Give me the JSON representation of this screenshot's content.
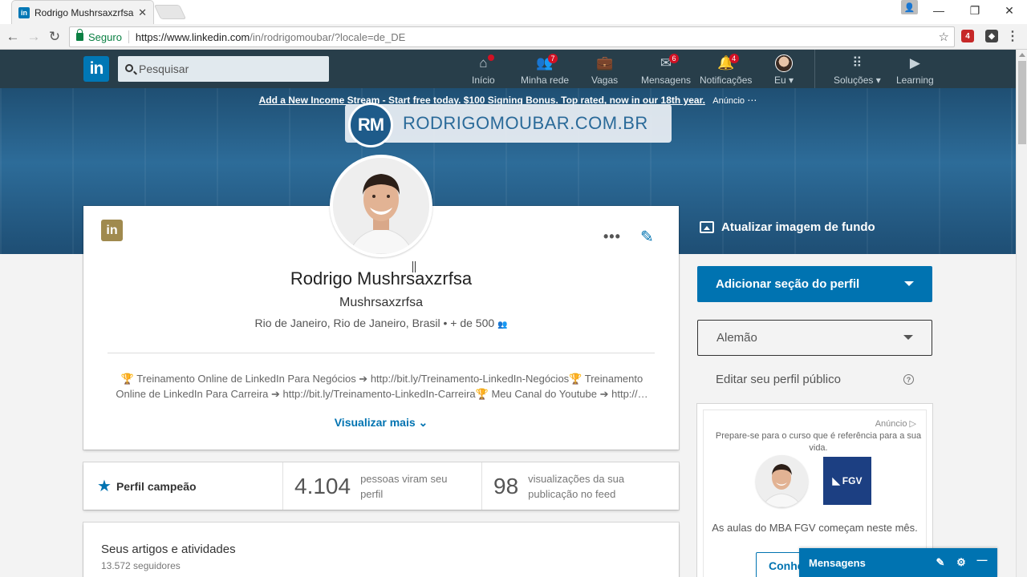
{
  "browser": {
    "tab_title": "Rodrigo Mushrsaxzrfsa | L",
    "tab_favicon": "in",
    "secure_label": "Seguro",
    "url_host": "https://www.linkedin.com",
    "url_path": "/in/rodrigomoubar/?locale=de_DE",
    "ext_badge": "4"
  },
  "nav": {
    "logo": "in",
    "search_placeholder": "Pesquisar",
    "items": [
      {
        "label": "Início",
        "icon": "home-icon",
        "badge": ""
      },
      {
        "label": "Minha rede",
        "icon": "network-icon",
        "badge": "7"
      },
      {
        "label": "Vagas",
        "icon": "briefcase-icon",
        "badge": ""
      },
      {
        "label": "Mensagens",
        "icon": "messages-icon",
        "badge": "6"
      },
      {
        "label": "Notificações",
        "icon": "bell-icon",
        "badge": "4"
      },
      {
        "label": "Eu",
        "icon": "avatar",
        "badge": ""
      },
      {
        "label": "Soluções",
        "icon": "grid-icon",
        "badge": ""
      },
      {
        "label": "Learning",
        "icon": "learning-icon",
        "badge": ""
      }
    ]
  },
  "banner": {
    "ad_link": "Add a New Income Stream - Start free today. $100 Signing Bonus. Top rated, now in our 18th year.",
    "ad_tag": "Anúncio",
    "rm_initials": "RM",
    "rm_site": "RODRIGOMOUBAR.COM.BR",
    "update_bg": "Atualizar imagem de fundo"
  },
  "profile": {
    "card_logo": "in",
    "name": "Rodrigo Mushrsaxzrfsa",
    "headline": "Mushrsaxzrfsa",
    "location": "Rio de Janeiro, Rio de Janeiro, Brasil",
    "connections": "+ de 500",
    "summary": "🏆 Treinamento Online de LinkedIn Para Negócios ➔ http://bit.ly/Treinamento-LinkedIn-Negócios🏆 Treinamento Online de LinkedIn Para Carreira ➔ http://bit.ly/Treinamento-LinkedIn-Carreira🏆 Meu Canal do Youtube ➔ http://…",
    "show_more": "Visualizar mais"
  },
  "stats": {
    "champion": "Perfil campeão",
    "views_count": "4.104",
    "views_desc": "pessoas viram seu perfil",
    "feed_count": "98",
    "feed_desc": "visualizações da sua publicação no feed"
  },
  "articles": {
    "title": "Seus artigos e atividades",
    "followers": "13.572 seguidores"
  },
  "sidebar": {
    "add_section": "Adicionar seção do perfil",
    "language": "Alemão",
    "public_profile": "Editar seu perfil público",
    "ad": {
      "label": "Anúncio",
      "text": "Prepare-se para o curso que é referência para a sua vida.",
      "brand": "FGV",
      "caption": "As aulas do MBA FGV começam neste mês.",
      "cta": "Conhe"
    }
  },
  "messaging": {
    "label": "Mensagens"
  },
  "colors": {
    "linkedin_blue": "#0073b1",
    "nav_bg": "#283e4a",
    "badge_red": "#d11124"
  }
}
